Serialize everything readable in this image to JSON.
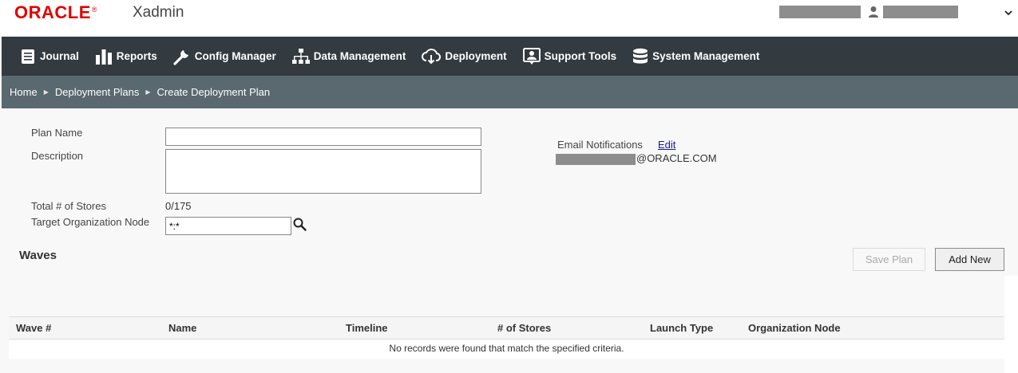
{
  "header": {
    "logo_text": "ORACLE",
    "logo_reg": "®",
    "app_name": "Xadmin",
    "caret": "⌄"
  },
  "nav": {
    "items": [
      {
        "label": "Journal",
        "icon": "journal-icon"
      },
      {
        "label": "Reports",
        "icon": "bar-chart-icon"
      },
      {
        "label": "Config Manager",
        "icon": "wrench-icon"
      },
      {
        "label": "Data Management",
        "icon": "hierarchy-icon"
      },
      {
        "label": "Deployment",
        "icon": "cloud-download-icon"
      },
      {
        "label": "Support Tools",
        "icon": "support-user-icon"
      },
      {
        "label": "System Management",
        "icon": "database-icon"
      }
    ]
  },
  "breadcrumb": {
    "items": [
      "Home",
      "Deployment Plans",
      "Create Deployment Plan"
    ],
    "separator": "▶"
  },
  "form": {
    "plan_name_label": "Plan Name",
    "plan_name_value": "",
    "description_label": "Description",
    "description_value": "",
    "total_stores_label": "Total # of Stores",
    "total_stores_value": "0/175",
    "target_node_label": "Target Organization Node",
    "target_node_value": "*:*",
    "email_label": "Email Notifications",
    "email_edit": "Edit",
    "email_domain": "@ORACLE.COM"
  },
  "waves": {
    "title": "Waves",
    "save_plan": "Save Plan",
    "add_new": "Add New",
    "columns": [
      "Wave #",
      "Name",
      "Timeline",
      "# of Stores",
      "Launch Type",
      "Organization Node"
    ],
    "empty_message": "No records were found that match the specified criteria."
  },
  "colors": {
    "brand_red": "#e00000",
    "nav_bg": "#333a40",
    "breadcrumb_bg": "#5a6870"
  }
}
